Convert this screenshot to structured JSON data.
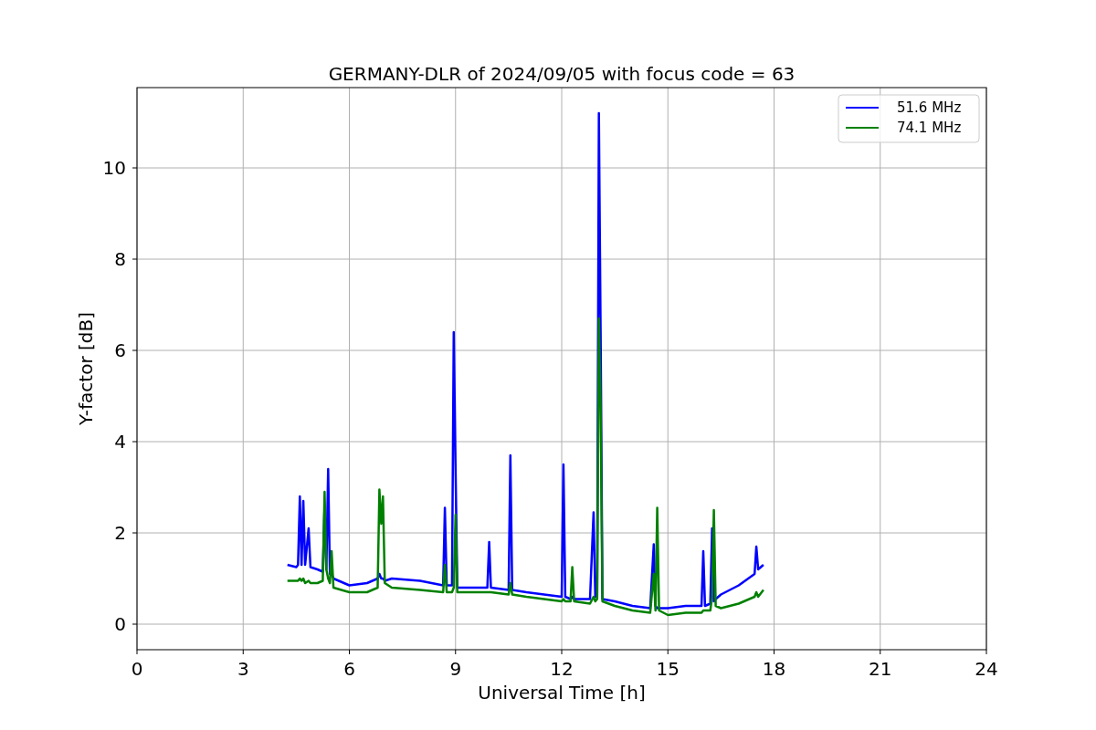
{
  "chart_data": {
    "type": "line",
    "title": "GERMANY-DLR of 2024/09/05 with focus code = 63",
    "xlabel": "Universal Time [h]",
    "ylabel": "Y-factor [dB]",
    "x": [
      4.25,
      4.5,
      4.55,
      4.6,
      4.65,
      4.7,
      4.75,
      4.85,
      4.9,
      5.1,
      5.25,
      5.3,
      5.35,
      5.4,
      5.45,
      5.5,
      5.55,
      6.0,
      6.5,
      6.8,
      6.85,
      6.9,
      6.95,
      7.0,
      7.2,
      8.0,
      8.65,
      8.7,
      8.75,
      8.9,
      8.95,
      9.0,
      9.05,
      9.5,
      9.9,
      9.95,
      10.0,
      10.5,
      10.55,
      10.6,
      11.0,
      11.5,
      12.0,
      12.05,
      12.1,
      12.25,
      12.3,
      12.35,
      12.8,
      12.9,
      12.95,
      13.0,
      13.05,
      13.1,
      13.15,
      13.5,
      14.0,
      14.5,
      14.6,
      14.65,
      14.7,
      14.75,
      15.0,
      15.5,
      15.95,
      16.0,
      16.05,
      16.2,
      16.25,
      16.3,
      16.35,
      16.5,
      17.0,
      17.45,
      17.5,
      17.55,
      17.7
    ],
    "series": [
      {
        "name": "51.6 MHz",
        "color": "#0000ff",
        "values": [
          1.3,
          1.25,
          1.3,
          2.8,
          1.3,
          2.7,
          1.3,
          2.1,
          1.25,
          1.2,
          1.15,
          2.6,
          1.2,
          3.4,
          1.1,
          1.1,
          1.0,
          0.85,
          0.9,
          1.0,
          1.1,
          1.0,
          1.0,
          0.95,
          1.0,
          0.95,
          0.85,
          2.55,
          0.85,
          0.85,
          6.4,
          3.4,
          0.8,
          0.8,
          0.8,
          1.8,
          0.8,
          0.75,
          3.7,
          0.75,
          0.7,
          0.65,
          0.6,
          3.5,
          0.6,
          0.55,
          0.6,
          0.55,
          0.55,
          2.45,
          0.6,
          0.6,
          11.2,
          6.4,
          0.55,
          0.5,
          0.4,
          0.35,
          1.75,
          0.4,
          0.35,
          0.35,
          0.35,
          0.4,
          0.4,
          1.6,
          0.4,
          0.45,
          2.1,
          0.5,
          0.55,
          0.65,
          0.85,
          1.1,
          1.7,
          1.2,
          1.3
        ]
      },
      {
        "name": "74.1 MHz",
        "color": "#008000",
        "values": [
          0.95,
          0.95,
          0.95,
          1.0,
          0.95,
          1.0,
          0.9,
          0.95,
          0.9,
          0.9,
          0.95,
          2.9,
          1.2,
          1.0,
          0.9,
          1.6,
          0.8,
          0.7,
          0.7,
          0.8,
          2.95,
          2.2,
          2.8,
          0.9,
          0.8,
          0.75,
          0.7,
          1.3,
          0.7,
          0.7,
          0.8,
          2.4,
          0.7,
          0.7,
          0.7,
          0.7,
          0.7,
          0.65,
          0.9,
          0.65,
          0.6,
          0.55,
          0.5,
          0.55,
          0.5,
          0.5,
          1.25,
          0.5,
          0.45,
          0.6,
          0.5,
          0.55,
          6.7,
          4.8,
          0.5,
          0.4,
          0.3,
          0.25,
          1.1,
          0.3,
          2.55,
          0.3,
          0.2,
          0.25,
          0.25,
          0.3,
          0.3,
          0.3,
          0.6,
          2.5,
          0.4,
          0.35,
          0.45,
          0.6,
          0.7,
          0.6,
          0.75
        ]
      }
    ],
    "xlim": [
      0,
      24
    ],
    "ylim": [
      -0.56,
      11.76
    ],
    "xticks": [
      0,
      3,
      6,
      9,
      12,
      15,
      18,
      21,
      24
    ],
    "yticks": [
      0,
      2,
      4,
      6,
      8,
      10
    ],
    "grid": true,
    "legend": true
  }
}
